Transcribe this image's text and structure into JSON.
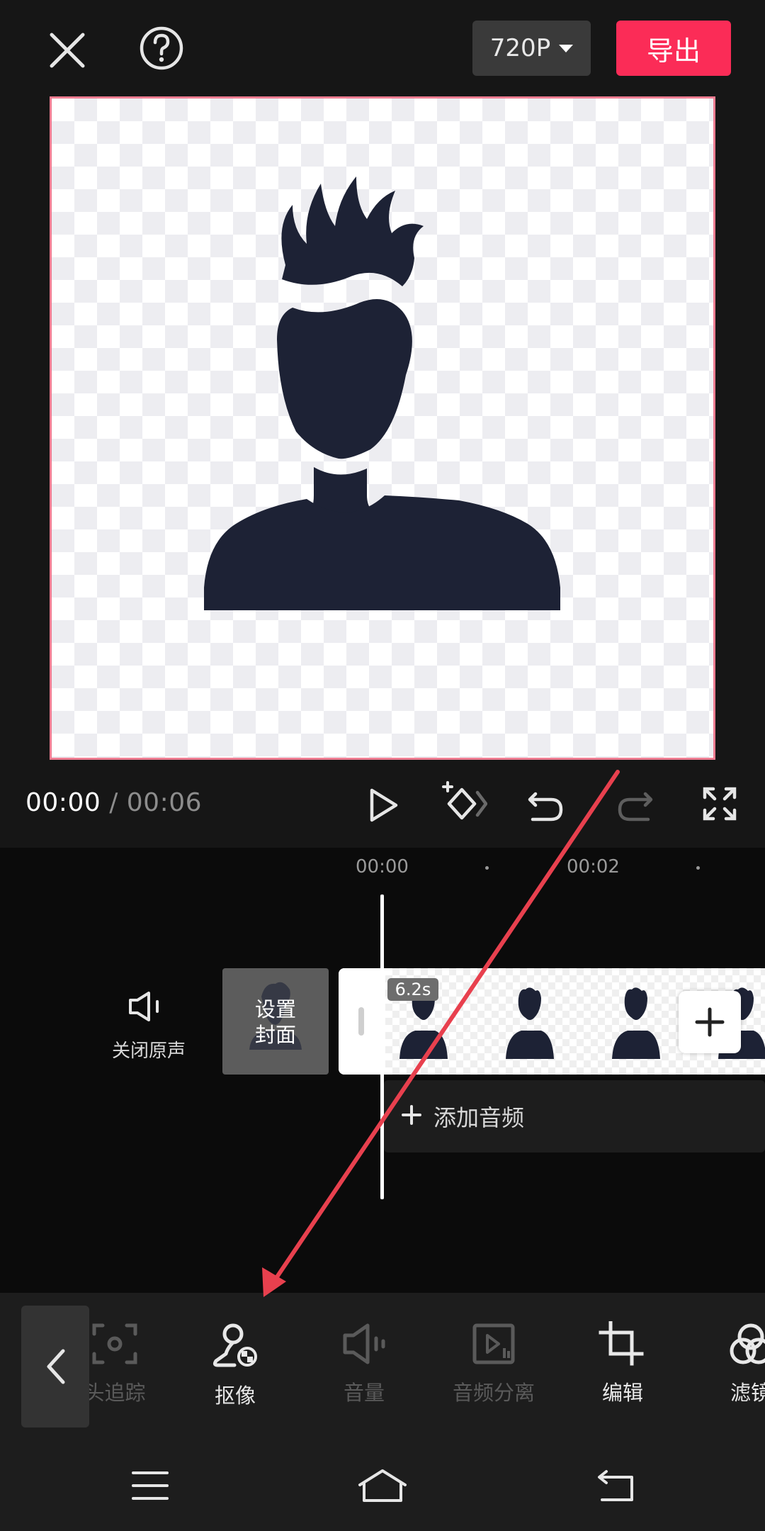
{
  "header": {
    "close_icon": "close-icon",
    "help_icon": "help-icon",
    "resolution_label": "720P",
    "export_label": "导出"
  },
  "colors": {
    "accent": "#fb2c57",
    "preview_border": "#ef7d92",
    "figure": "#1d2235",
    "arrow": "#e8404e"
  },
  "preview": {
    "content": "person-silhouette-icon on transparent checkerboard"
  },
  "player": {
    "current_time": "00:00",
    "separator": " / ",
    "total_time": "00:06",
    "icons": [
      "play-icon",
      "keyframe-add-icon",
      "undo-icon",
      "redo-icon",
      "fullscreen-icon"
    ]
  },
  "timeline": {
    "ruler_labels": [
      "00:00",
      "00:02"
    ],
    "mute_label": "关闭原声",
    "cover_label_line1": "设置",
    "cover_label_line2": "封面",
    "clip_duration": "6.2s",
    "add_audio_label": "添加音频"
  },
  "toolbar": {
    "items": [
      {
        "label": "头追踪",
        "icon": "head-tracking-icon",
        "enabled": false
      },
      {
        "label": "抠像",
        "icon": "cutout-icon",
        "enabled": true
      },
      {
        "label": "音量",
        "icon": "volume-icon",
        "enabled": false
      },
      {
        "label": "音频分离",
        "icon": "audio-separate-icon",
        "enabled": false
      },
      {
        "label": "编辑",
        "icon": "crop-icon",
        "enabled": true
      },
      {
        "label": "滤镜",
        "icon": "filter-icon",
        "enabled": true
      }
    ]
  },
  "navbar": {
    "icons": [
      "menu-icon",
      "home-icon",
      "back-icon"
    ]
  }
}
